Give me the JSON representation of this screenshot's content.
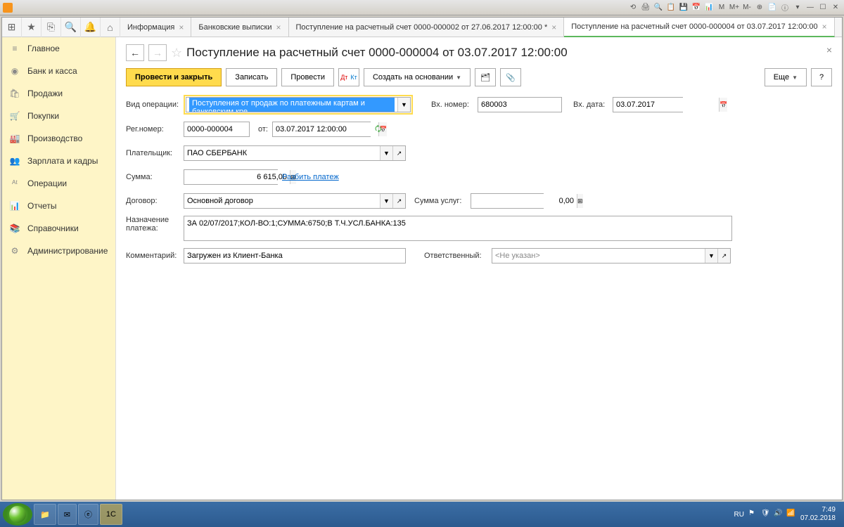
{
  "titlebar_icons": [
    "⟲",
    "🖨",
    "🔍",
    "📋",
    "💾",
    "📅",
    "📊",
    "M",
    "M+",
    "M-",
    "⊕",
    "📄",
    "ⓘ",
    "▾",
    "—",
    "☐",
    "✕"
  ],
  "toolbar": {
    "icons": [
      "⊞",
      "★",
      "⎘",
      "🔍",
      "🔔"
    ]
  },
  "tabs": [
    {
      "label": "Информация",
      "closable": true
    },
    {
      "label": "Банковские выписки",
      "closable": true
    },
    {
      "label": "Поступление на расчетный счет 0000-000002 от 27.06.2017 12:00:00 *",
      "closable": true
    },
    {
      "label": "Поступление на расчетный счет 0000-000004 от 03.07.2017 12:00:00",
      "closable": true,
      "active": true
    }
  ],
  "sidebar": {
    "items": [
      {
        "icon": "≡",
        "label": "Главное"
      },
      {
        "icon": "◉",
        "label": "Банк и касса"
      },
      {
        "icon": "🛍",
        "label": "Продажи"
      },
      {
        "icon": "🛒",
        "label": "Покупки"
      },
      {
        "icon": "🏭",
        "label": "Производство"
      },
      {
        "icon": "👥",
        "label": "Зарплата и кадры"
      },
      {
        "icon": "ᴬᵗ",
        "label": "Операции"
      },
      {
        "icon": "📊",
        "label": "Отчеты"
      },
      {
        "icon": "📚",
        "label": "Справочники"
      },
      {
        "icon": "⚙",
        "label": "Администрирование"
      }
    ]
  },
  "page": {
    "title": "Поступление на расчетный счет 0000-000004 от 03.07.2017 12:00:00",
    "actions": {
      "submit_close": "Провести и закрыть",
      "save": "Записать",
      "submit": "Провести",
      "create_based": "Создать на основании",
      "more": "Еще",
      "help": "?"
    },
    "fields": {
      "op_type_label": "Вид операции:",
      "op_type_value": "Поступления от продаж по платежным картам и банковским кре",
      "in_number_label": "Вх. номер:",
      "in_number_value": "680003",
      "in_date_label": "Вх. дата:",
      "in_date_value": "03.07.2017",
      "reg_number_label": "Рег.номер:",
      "reg_number_value": "0000-000004",
      "from_label": "от:",
      "from_value": "03.07.2017 12:00:00",
      "payer_label": "Плательщик:",
      "payer_value": "ПАО СБЕРБАНК",
      "amount_label": "Сумма:",
      "amount_value": "6 615,00",
      "split_link": "Разбить платеж",
      "contract_label": "Договор:",
      "contract_value": "Основной договор",
      "service_amount_label": "Сумма услуг:",
      "service_amount_value": "0,00",
      "purpose_label": "Назначение платежа:",
      "purpose_value": "ЗА 02/07/2017;КОЛ-ВО:1;СУММА:6750;В Т.Ч.УСЛ.БАНКА:135",
      "comment_label": "Комментарий:",
      "comment_value": "Загружен из Клиент-Банка",
      "responsible_label": "Ответственный:",
      "responsible_value": "<Не указан>"
    }
  },
  "taskbar": {
    "lang": "RU",
    "time": "7:49",
    "date": "07.02.2018"
  }
}
